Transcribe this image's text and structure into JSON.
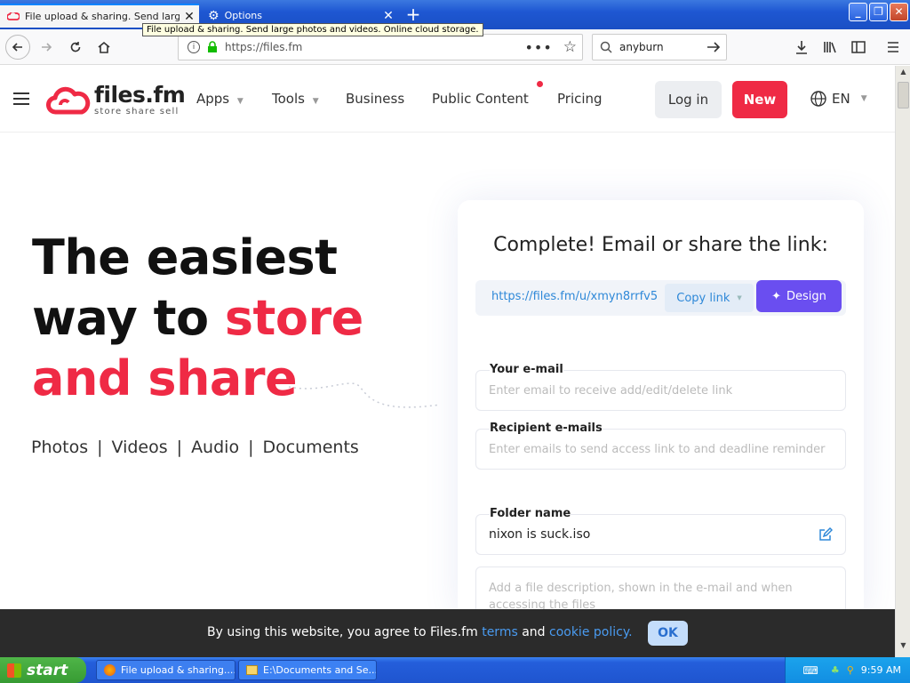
{
  "browser": {
    "tabs": [
      {
        "label": "File upload & sharing. Send large p"
      },
      {
        "label": "Options"
      }
    ],
    "tooltip": "File upload & sharing. Send large photos and videos. Online cloud storage.",
    "url": "https://files.fm",
    "search_value": "anyburn"
  },
  "site": {
    "logo_name": "files.fm",
    "logo_tagline": "store share sell",
    "nav": [
      "Apps",
      "Tools",
      "Business",
      "Public Content",
      "Pricing"
    ],
    "login_label": "Log in",
    "new_label": "New",
    "lang": "EN",
    "accent": "#ef2a45"
  },
  "hero": {
    "line1": "The easiest",
    "line2a": "way to ",
    "line2b": "store",
    "line3": "and share",
    "categories": [
      "Photos",
      "Videos",
      "Audio",
      "Documents"
    ]
  },
  "upload_card": {
    "title": "Complete! Email or share the link:",
    "share_link": "https://files.fm/u/xmyn8rrfv5",
    "copy_label": "Copy link",
    "design_label": "Design",
    "email_label": "Your e-mail",
    "email_placeholder": "Enter email to receive add/edit/delete link",
    "recipient_label": "Recipient e-mails",
    "recipient_placeholder": "Enter emails to send access link to and deadline reminder",
    "folder_label": "Folder name",
    "folder_value": "nixon is suck.iso",
    "description_placeholder": "Add a file description, shown in the e-mail and when accessing the files"
  },
  "cookie": {
    "text_before": "By using this website, you agree to Files.fm ",
    "terms": "terms",
    "and": " and ",
    "policy": "cookie policy.",
    "ok": "OK"
  },
  "taskbar": {
    "start": "start",
    "tasks": [
      "File upload & sharing....",
      "E:\\Documents and Se..."
    ],
    "clock": "9:59 AM"
  }
}
